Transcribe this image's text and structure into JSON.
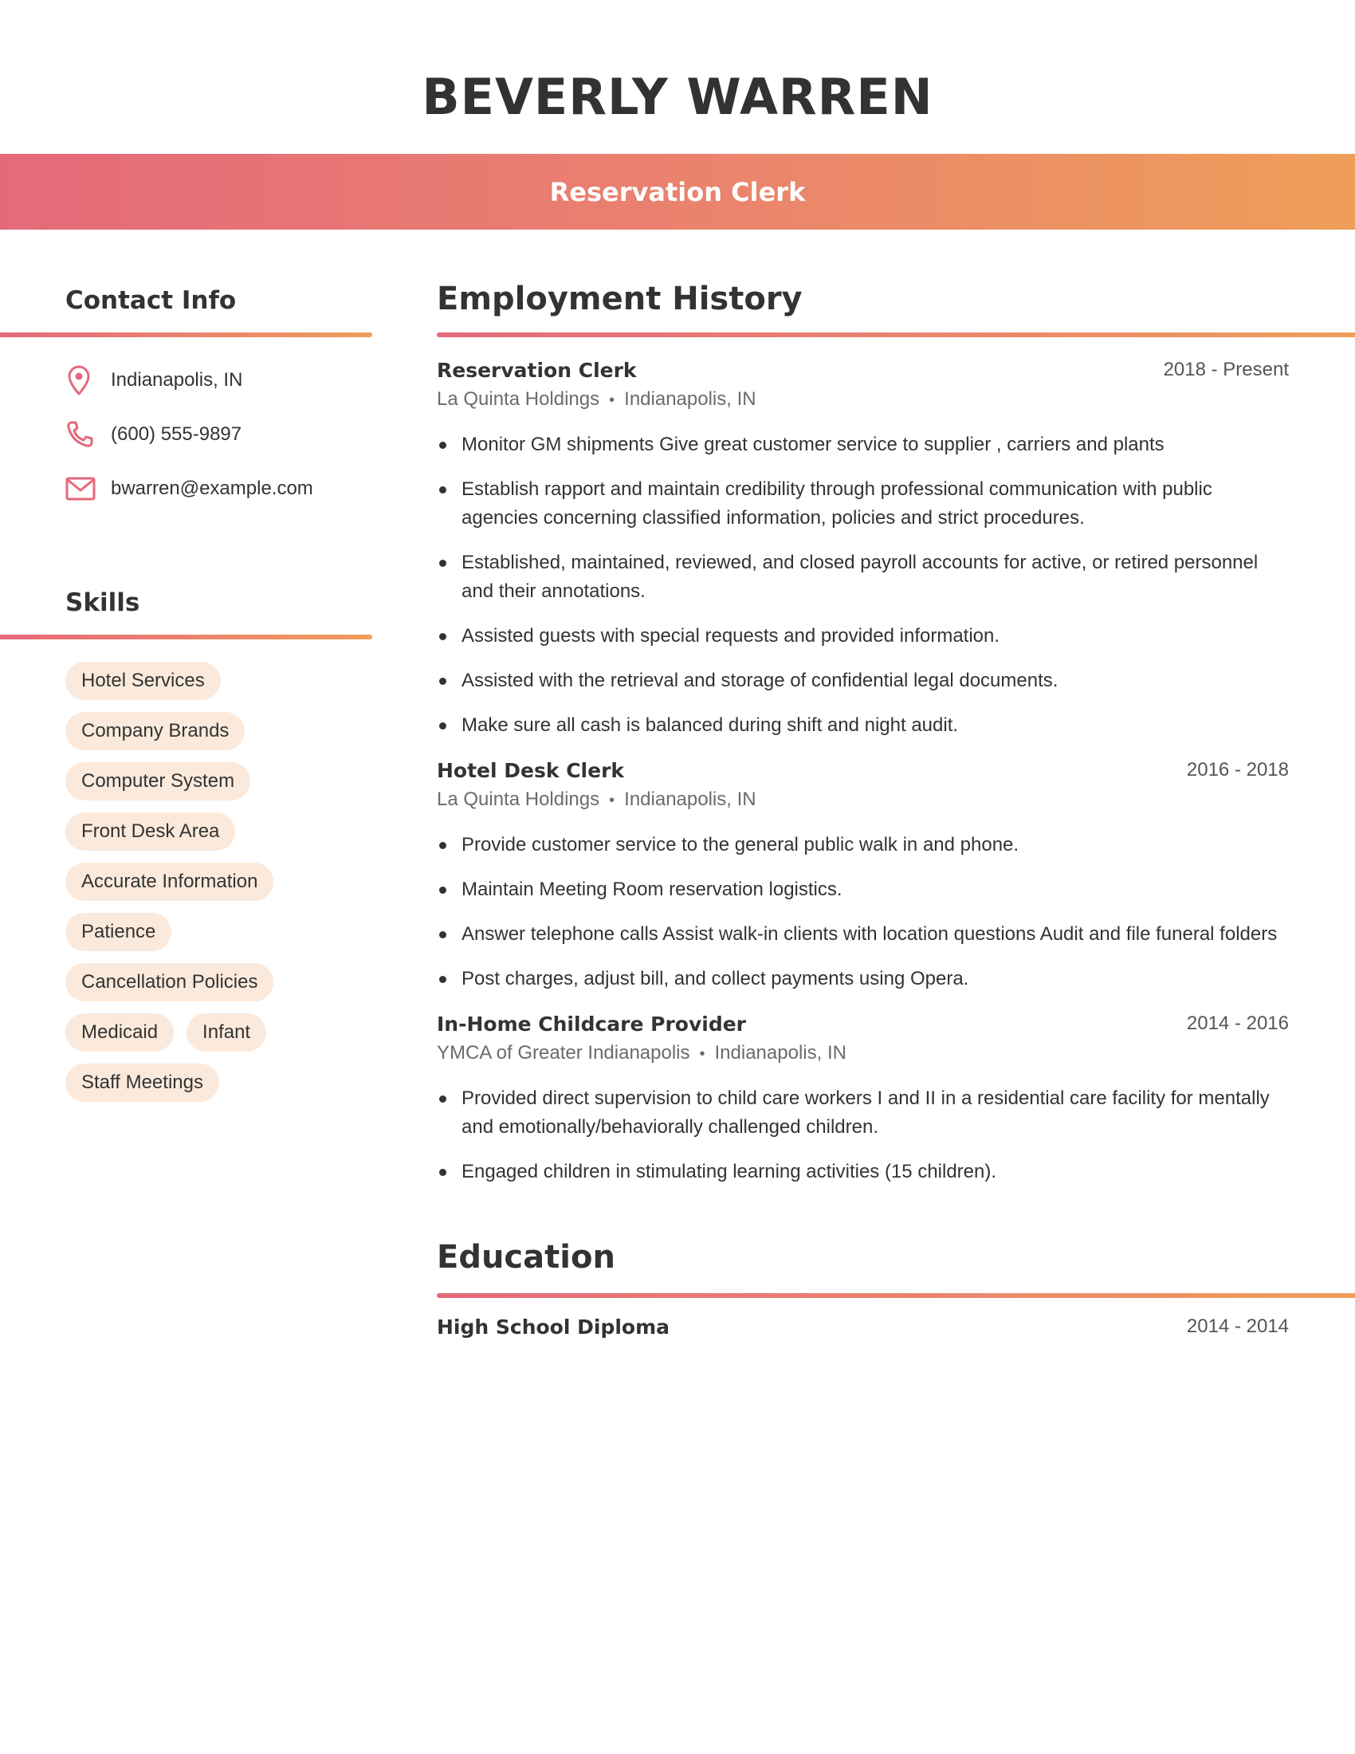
{
  "header": {
    "name": "BEVERLY WARREN",
    "job_title": "Reservation Clerk"
  },
  "colors": {
    "gradient_start": "#E5697A",
    "gradient_end": "#EE9E5A",
    "icon": "#E5697A",
    "pill_bg": "#FBEADC",
    "text": "#333333"
  },
  "contact": {
    "heading": "Contact Info",
    "items": [
      {
        "icon": "location-pin-icon",
        "value": "Indianapolis, IN"
      },
      {
        "icon": "phone-icon",
        "value": "(600) 555-9897"
      },
      {
        "icon": "mail-icon",
        "value": "bwarren@example.com"
      }
    ]
  },
  "skills": {
    "heading": "Skills",
    "items": [
      "Hotel Services",
      "Company Brands",
      "Computer System",
      "Front Desk Area",
      "Accurate Information",
      "Patience",
      "Cancellation Policies",
      "Medicaid",
      "Infant",
      "Staff Meetings"
    ]
  },
  "employment": {
    "heading": "Employment History",
    "separator": "•",
    "jobs": [
      {
        "title": "Reservation Clerk",
        "dates": "2018 - Present",
        "company": "La Quinta Holdings",
        "location": "Indianapolis, IN",
        "bullets": [
          "Monitor GM shipments Give great customer service to supplier , carriers and plants",
          "Establish rapport and maintain credibility through professional communication with public agencies concerning classified information, policies and strict procedures.",
          "Established, maintained, reviewed, and closed payroll accounts for active, or retired personnel and their annotations.",
          "Assisted guests with special requests and provided information.",
          "Assisted with the retrieval and storage of confidential legal documents.",
          "Make sure all cash is balanced during shift and night audit."
        ]
      },
      {
        "title": "Hotel Desk Clerk",
        "dates": "2016 - 2018",
        "company": "La Quinta Holdings",
        "location": "Indianapolis, IN",
        "bullets": [
          "Provide customer service to the general public walk in and phone.",
          "Maintain Meeting Room reservation logistics.",
          "Answer telephone calls Assist walk-in clients with location questions Audit and file funeral folders",
          "Post charges, adjust bill, and collect payments using Opera."
        ]
      },
      {
        "title": "In-Home Childcare Provider",
        "dates": "2014 - 2016",
        "company": "YMCA of Greater Indianapolis",
        "location": "Indianapolis, IN",
        "bullets": [
          "Provided direct supervision to child care workers I and II in a residential care facility for mentally and emotionally/behaviorally challenged children.",
          "Engaged children in stimulating learning activities (15 children)."
        ]
      }
    ]
  },
  "education": {
    "heading": "Education",
    "items": [
      {
        "degree": "High School Diploma",
        "dates": "2014 - 2014"
      }
    ]
  }
}
